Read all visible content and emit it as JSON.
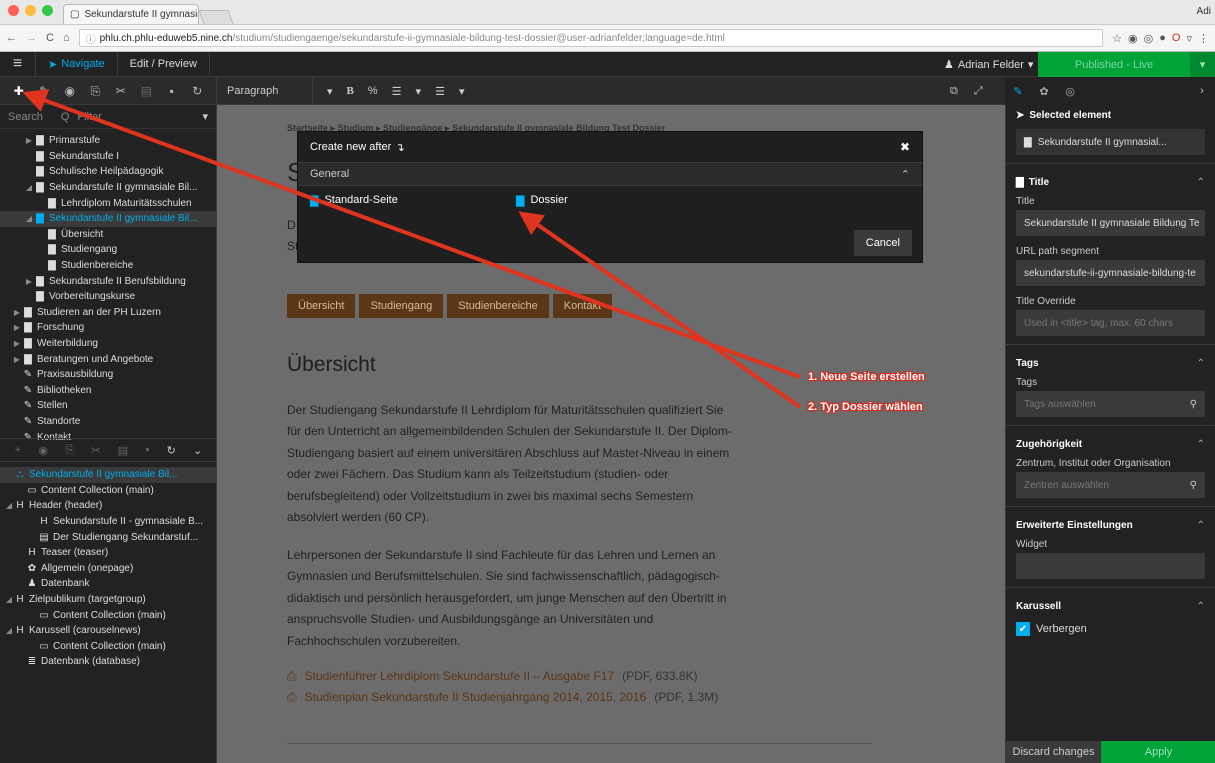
{
  "browser": {
    "tab_title": "Sekundarstufe II gymnasiale Bi",
    "profile": "Adi",
    "url_host": "phlu.ch.phlu-eduweb5.nine.ch",
    "url_path": "/studium/studiengaenge/sekundarstufe-ii-gymnasiale-bildung-test-dossier@user-adrianfelder;language=de.html"
  },
  "topbar": {
    "navigate": "Navigate",
    "edit_preview": "Edit / Preview",
    "user": "Adrian Felder",
    "published": "Published - Live"
  },
  "toolbar": {
    "paragraph": "Paragraph"
  },
  "sidebar": {
    "search_placeholder": "Search",
    "filter_label": "Filter",
    "tree": [
      {
        "label": "Primarstufe",
        "level": 1,
        "toggle": "▶",
        "icon": "page-icon",
        "selected": false
      },
      {
        "label": "Sekundarstufe I",
        "level": 1,
        "toggle": "",
        "icon": "page-icon",
        "selected": false
      },
      {
        "label": "Schulische Heilpädagogik",
        "level": 1,
        "toggle": "",
        "icon": "page-icon",
        "selected": false
      },
      {
        "label": "Sekundarstufe II gymnasiale Bil...",
        "level": 1,
        "toggle": "◢",
        "icon": "page-icon",
        "selected": false
      },
      {
        "label": "Lehrdiplom Maturitätsschulen",
        "level": 2,
        "toggle": "",
        "icon": "page-icon",
        "selected": false
      },
      {
        "label": "Sekundarstufe II gymnasiale Bil...",
        "level": 1,
        "toggle": "◢",
        "icon": "page-icon",
        "selected": true
      },
      {
        "label": "Übersicht",
        "level": 2,
        "toggle": "",
        "icon": "page-icon",
        "selected": false
      },
      {
        "label": "Studiengang",
        "level": 2,
        "toggle": "",
        "icon": "page-icon",
        "selected": false
      },
      {
        "label": "Studienbereiche",
        "level": 2,
        "toggle": "",
        "icon": "page-icon",
        "selected": false
      },
      {
        "label": "Sekundarstufe II Berufsbildung",
        "level": 1,
        "toggle": "▶",
        "icon": "page-icon",
        "selected": false
      },
      {
        "label": "Vorbereitungskurse",
        "level": 1,
        "toggle": "",
        "icon": "page-icon",
        "selected": false
      },
      {
        "label": "Studieren an der PH Luzern",
        "level": 0,
        "toggle": "▶",
        "icon": "page-icon",
        "selected": false
      },
      {
        "label": "Forschung",
        "level": 0,
        "toggle": "▶",
        "icon": "page-icon",
        "selected": false
      },
      {
        "label": "Weiterbildung",
        "level": 0,
        "toggle": "▶",
        "icon": "page-icon",
        "selected": false
      },
      {
        "label": "Beratungen und Angebote",
        "level": 0,
        "toggle": "▶",
        "icon": "page-icon",
        "selected": false
      },
      {
        "label": "Praxisausbildung",
        "level": 0,
        "toggle": "",
        "icon": "wrench-icon",
        "selected": false
      },
      {
        "label": "Bibliotheken",
        "level": 0,
        "toggle": "",
        "icon": "wrench-icon",
        "selected": false
      },
      {
        "label": "Stellen",
        "level": 0,
        "toggle": "",
        "icon": "wrench-icon",
        "selected": false
      },
      {
        "label": "Standorte",
        "level": 0,
        "toggle": "",
        "icon": "wrench-icon",
        "selected": false
      },
      {
        "label": "Kontakt",
        "level": 0,
        "toggle": "",
        "icon": "wrench-icon",
        "selected": false
      }
    ],
    "content_tree": [
      {
        "label": "Sekundarstufe II gymnasiale Bil...",
        "level": 0,
        "toggle": "",
        "icon": "sitemap-icon",
        "selected": true
      },
      {
        "label": "Content Collection (main)",
        "level": 1,
        "toggle": "",
        "icon": "folder-icon",
        "selected": false
      },
      {
        "label": "Header (header)",
        "level": 0,
        "toggle": "◢",
        "icon": "heading-icon",
        "selected": false
      },
      {
        "label": "Sekundarstufe II - gymnasiale B...",
        "level": 2,
        "toggle": "",
        "icon": "heading-icon",
        "selected": false
      },
      {
        "label": "Der Studiengang Sekundarstuf...",
        "level": 2,
        "toggle": "",
        "icon": "text-icon",
        "selected": false
      },
      {
        "label": "Teaser (teaser)",
        "level": 1,
        "toggle": "",
        "icon": "heading-icon",
        "selected": false
      },
      {
        "label": "Allgemein (onepage)",
        "level": 1,
        "toggle": "",
        "icon": "gear-icon",
        "selected": false
      },
      {
        "label": "Datenbank",
        "level": 1,
        "toggle": "",
        "icon": "person-icon",
        "selected": false
      },
      {
        "label": "Zielpublikum (targetgroup)",
        "level": 0,
        "toggle": "◢",
        "icon": "heading-icon",
        "selected": false
      },
      {
        "label": "Content Collection (main)",
        "level": 2,
        "toggle": "",
        "icon": "folder-icon",
        "selected": false
      },
      {
        "label": "Karussell (carouselnews)",
        "level": 0,
        "toggle": "◢",
        "icon": "heading-icon",
        "selected": false
      },
      {
        "label": "Content Collection (main)",
        "level": 2,
        "toggle": "",
        "icon": "folder-icon",
        "selected": false
      },
      {
        "label": "Datenbank (database)",
        "level": 1,
        "toggle": "",
        "icon": "database-icon",
        "selected": false
      }
    ]
  },
  "page": {
    "breadcrumb": "Startseite   ▸   Studium   ▸   Studiengänge   ▸   Sekundarstufe II gymnasiale Bildung Test Dossier",
    "title_initial": "S",
    "intro_line1": "D",
    "intro_line2": "St",
    "tabs": [
      "Übersicht",
      "Studiengang",
      "Studienbereiche",
      "Kontakt"
    ],
    "heading": "Übersicht",
    "paragraph1": "Der Studiengang Sekundarstufe II Lehrdiplom für Maturitätsschulen qualifiziert Sie für den Unterricht an allgemeinbildenden Schulen der Sekundarstufe II. Der Diplom-Studiengang basiert auf einem universitären Abschluss auf Master-Niveau in einem oder zwei Fächern. Das Studium kann als Teilzeitstudium (studien- oder berufsbegleitend) oder Vollzeitstudium in zwei bis maximal sechs Semestern absolviert werden (60 CP).",
    "paragraph2": "Lehrpersonen der Sekundarstufe II sind Fachleute für das Lehren und Lernen an Gymnasien und Berufsmittelschulen. Sie sind fachwissenschaftlich, pädagogisch-didaktisch und persönlich herausgefordert, um junge Menschen auf den Übertritt in anspruchsvolle Studien- und Ausbildungsgänge an Universitäten und Fachhochschulen vorzubereiten.",
    "downloads": [
      {
        "label": "Studienführer Lehrdiplom Sekundarstufe II – Ausgabe F17",
        "meta": "(PDF, 633.8K)"
      },
      {
        "label": "Studienplan Sekundarstufe II Studienjahrgang 2014, 2015, 2016",
        "meta": "(PDF, 1.3M)"
      }
    ]
  },
  "modal": {
    "title": "Create new after",
    "group": "General",
    "items": [
      "Standard-Seite",
      "Dossier"
    ],
    "cancel": "Cancel"
  },
  "inspector": {
    "selected_heading": "Selected element",
    "selected_value": "Sekundarstufe II gymnasial...",
    "title_section": "Title",
    "title_label": "Title",
    "title_value": "Sekundarstufe II gymnasiale Bildung Te",
    "url_label": "URL path segment",
    "url_value": "sekundarstufe-ii-gymnasiale-bildung-te",
    "override_label": "Title Override",
    "override_placeholder": "Used in <title> tag, max. 60 chars",
    "tags_section": "Tags",
    "tags_label": "Tags",
    "tags_placeholder": "Tags auswählen",
    "zug_section": "Zugehörigkeit",
    "zug_label": "Zentrum, Institut oder Organisation",
    "zug_placeholder": "Zentren auswählen",
    "erw_section": "Erweiterte Einstellungen",
    "widget_label": "Widget",
    "kar_section": "Karussell",
    "kar_checkbox": "Verbergen",
    "discard": "Discard changes",
    "apply": "Apply"
  },
  "annotations": {
    "step1": "1. Neue Seite erstellen",
    "step2": "2. Typ Dossier wählen",
    "color": "#e0341f"
  }
}
